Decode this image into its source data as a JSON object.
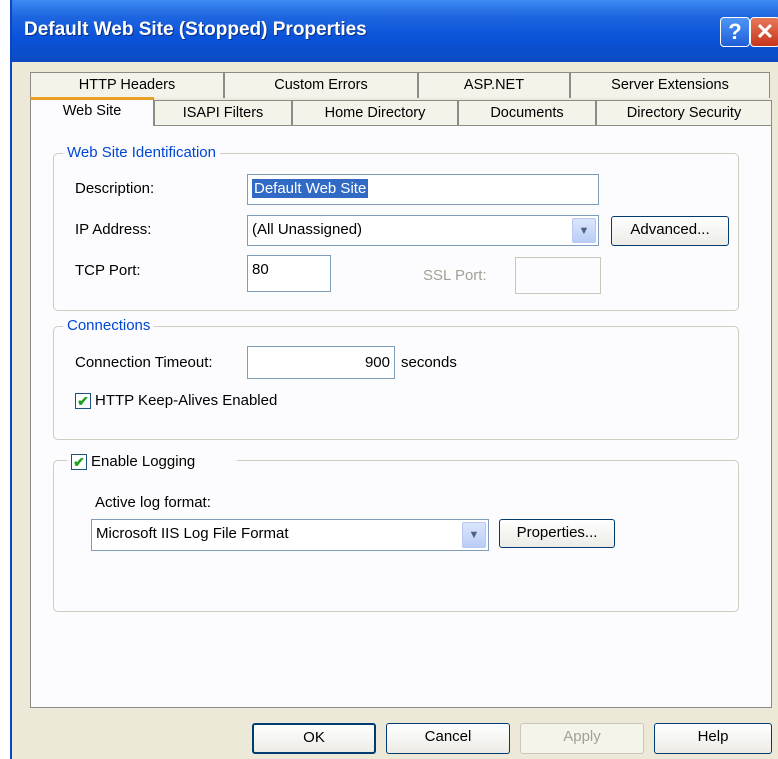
{
  "window": {
    "title": "Default Web Site (Stopped) Properties",
    "help_glyph": "?",
    "close_glyph": "✕"
  },
  "tabs_back": [
    "HTTP Headers",
    "Custom Errors",
    "ASP.NET",
    "Server Extensions"
  ],
  "tabs_front": [
    "Web Site",
    "ISAPI Filters",
    "Home Directory",
    "Documents",
    "Directory Security"
  ],
  "active_tab": "Web Site",
  "identification": {
    "legend": "Web Site Identification",
    "description_label": "Description:",
    "description_value": "Default Web Site",
    "ip_label": "IP Address:",
    "ip_value": "(All Unassigned)",
    "advanced_label": "Advanced...",
    "tcp_label": "TCP Port:",
    "tcp_value": "80",
    "ssl_label": "SSL Port:",
    "ssl_value": ""
  },
  "connections": {
    "legend": "Connections",
    "timeout_label": "Connection Timeout:",
    "timeout_value": "900",
    "timeout_unit": "seconds",
    "keepalive_label": "HTTP Keep-Alives Enabled",
    "keepalive_checked": true
  },
  "logging": {
    "enable_label": "Enable Logging",
    "enable_checked": true,
    "format_label": "Active log format:",
    "format_value": "Microsoft IIS Log File Format",
    "properties_label": "Properties..."
  },
  "footer": {
    "ok": "OK",
    "cancel": "Cancel",
    "apply": "Apply",
    "help": "Help"
  },
  "icons": {
    "check": "✔",
    "dropdown": "▼"
  },
  "colors": {
    "titlebar": "#0a53d9",
    "legend": "#0046d5",
    "tab_highlight": "#e8a025",
    "close": "#c6361c"
  }
}
